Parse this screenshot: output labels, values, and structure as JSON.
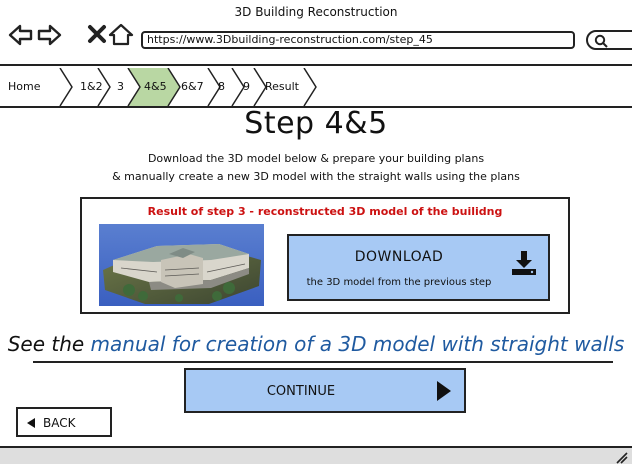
{
  "window": {
    "title": "3D Building Reconstruction",
    "url": "https://www.3Dbuilding-reconstruction.com/step_45"
  },
  "nav_icons": [
    "back-arrow-icon",
    "forward-arrow-icon",
    "close-x-icon",
    "home-icon"
  ],
  "search": {
    "icon": "search-icon"
  },
  "breadcrumb": {
    "items": [
      {
        "label": "Home",
        "active": false
      },
      {
        "label": "1&2",
        "active": false
      },
      {
        "label": "3",
        "active": false
      },
      {
        "label": "4&5",
        "active": true
      },
      {
        "label": "6&7",
        "active": false
      },
      {
        "label": "8",
        "active": false
      },
      {
        "label": "9",
        "active": false
      },
      {
        "label": "Result",
        "active": false
      }
    ],
    "active_color": "#b9d7a3"
  },
  "main": {
    "title": "Step 4&5",
    "instruction_1": "Download the 3D model below & prepare your building plans",
    "instruction_2": "& manually create a new 3D model with the straight walls using the plans"
  },
  "result_panel": {
    "caption": "Result of step 3 - reconstructed 3D model of the builidng",
    "caption_color": "#cc1111",
    "image_icon": "building-model-image"
  },
  "download": {
    "title": "DOWNLOAD",
    "subtitle": "the 3D model from the previous step",
    "icon": "download-icon"
  },
  "manual": {
    "prefix": "See the",
    "link_text": "manual for creation of a 3D model with straight walls",
    "link_color": "#1f5aa0"
  },
  "continue": {
    "label": "CONTINUE",
    "icon": "play-arrow-icon"
  },
  "back": {
    "label": "BACK",
    "icon": "back-triangle-icon"
  },
  "colors": {
    "button_fill": "#a7c9f4",
    "footer": "#dedede"
  }
}
